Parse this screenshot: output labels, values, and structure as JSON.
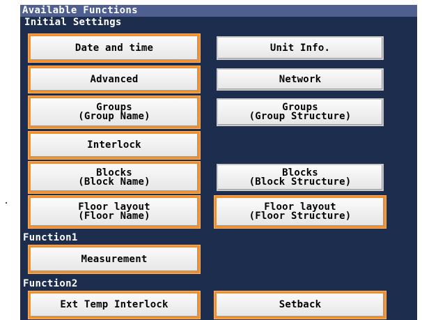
{
  "header": {
    "title": "Available Functions"
  },
  "sections": {
    "initial": "Initial Settings",
    "function1": "Function1",
    "function2": "Function2"
  },
  "buttons": {
    "date_time": {
      "label": "Date and time",
      "selected": true
    },
    "unit_info": {
      "label": "Unit Info.",
      "selected": false
    },
    "advanced": {
      "label": "Advanced",
      "selected": true
    },
    "network": {
      "label": "Network",
      "selected": false
    },
    "groups_name": {
      "line1": "Groups",
      "line2": "(Group Name)",
      "selected": true
    },
    "groups_structure": {
      "line1": "Groups",
      "line2": "(Group Structure)",
      "selected": false
    },
    "interlock": {
      "label": "Interlock",
      "selected": true
    },
    "blocks_name": {
      "line1": "Blocks",
      "line2": "(Block Name)",
      "selected": true
    },
    "blocks_structure": {
      "line1": "Blocks",
      "line2": "(Block Structure)",
      "selected": false
    },
    "floor_name": {
      "line1": "Floor layout",
      "line2": "(Floor Name)",
      "selected": true
    },
    "floor_structure": {
      "line1": "Floor layout",
      "line2": "(Floor Structure)",
      "selected": true
    },
    "measurement": {
      "label": "Measurement",
      "selected": true
    },
    "ext_temp": {
      "label": "Ext Temp Interlock",
      "selected": true
    },
    "setback": {
      "label": "Setback",
      "selected": true
    }
  },
  "colors": {
    "screen_bg": "#1c2d4e",
    "titlebar_bg": "#4f5f8f",
    "selected_border": "#f0902c",
    "button_bg": "#f2f2f2"
  }
}
